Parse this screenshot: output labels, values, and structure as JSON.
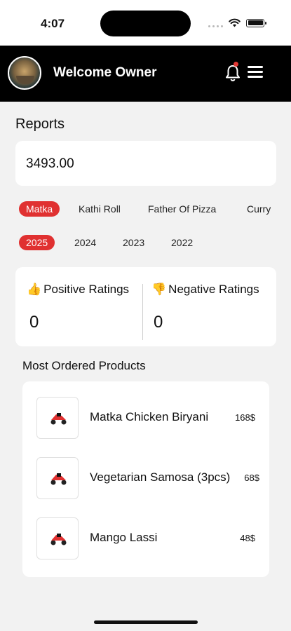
{
  "status_bar": {
    "time": "4:07"
  },
  "header": {
    "title": "Welcome Owner"
  },
  "reports": {
    "title": "Reports",
    "total": "3493.00"
  },
  "restaurants": [
    {
      "label": "Matka",
      "active": true
    },
    {
      "label": "Kathi Roll",
      "active": false
    },
    {
      "label": "Father Of Pizza",
      "active": false
    },
    {
      "label": "Curry",
      "active": false
    }
  ],
  "years": [
    {
      "label": "2025",
      "active": true
    },
    {
      "label": "2024",
      "active": false
    },
    {
      "label": "2023",
      "active": false
    },
    {
      "label": "2022",
      "active": false
    }
  ],
  "ratings": {
    "positive": {
      "label": "Positive Ratings",
      "value": "0"
    },
    "negative": {
      "label": "Negative Ratings",
      "value": "0"
    }
  },
  "most_ordered": {
    "title": "Most Ordered Products",
    "items": [
      {
        "name": "Matka Chicken Biryani",
        "price": "168$"
      },
      {
        "name": "Vegetarian Samosa (3pcs)",
        "price": "68$"
      },
      {
        "name": "Mango Lassi",
        "price": "48$"
      }
    ]
  },
  "colors": {
    "accent": "#e03131",
    "header_bg": "#000000",
    "page_bg": "#f2f2f2"
  },
  "icons": {
    "notification": "bell-icon",
    "menu": "hamburger-menu-icon",
    "positive": "thumbs-up-icon",
    "negative": "thumbs-down-icon"
  }
}
